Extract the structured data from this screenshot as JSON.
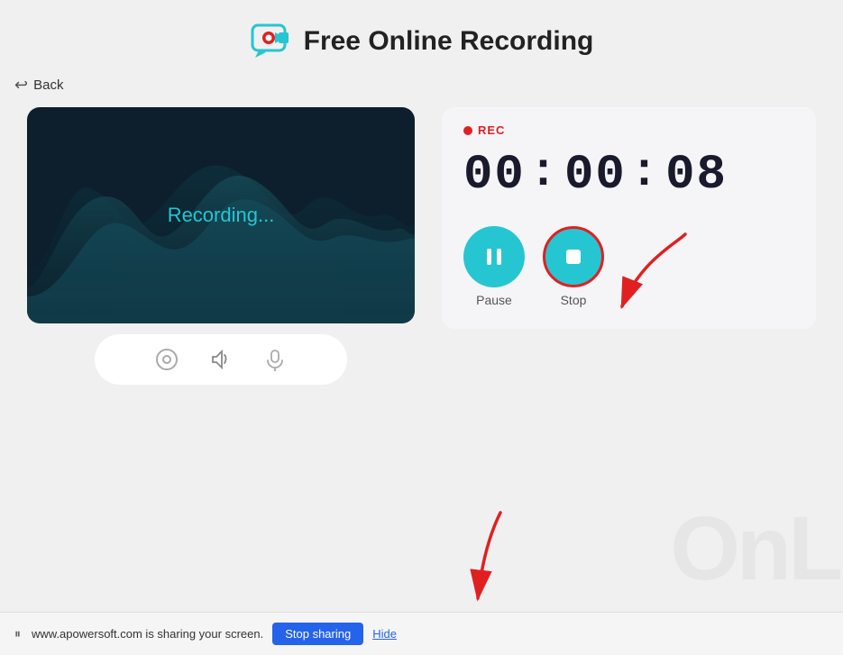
{
  "header": {
    "title": "Free Online Recording"
  },
  "back_button": {
    "label": "Back"
  },
  "recording": {
    "label": "Recording...",
    "status": "REC",
    "timer": {
      "hours": "00",
      "minutes": "00",
      "seconds": "08"
    }
  },
  "controls": {
    "pause_label": "Pause",
    "stop_label": "Stop"
  },
  "bottom_bar": {
    "sharing_text": "www.apowersoft.com is sharing your screen.",
    "stop_sharing_label": "Stop sharing",
    "hide_label": "Hide"
  },
  "icons": {
    "back_arrow": "↩",
    "pause": "⏸",
    "stop": "⏹",
    "camera": "◎",
    "speaker": "🔊",
    "mic": "🎤"
  }
}
